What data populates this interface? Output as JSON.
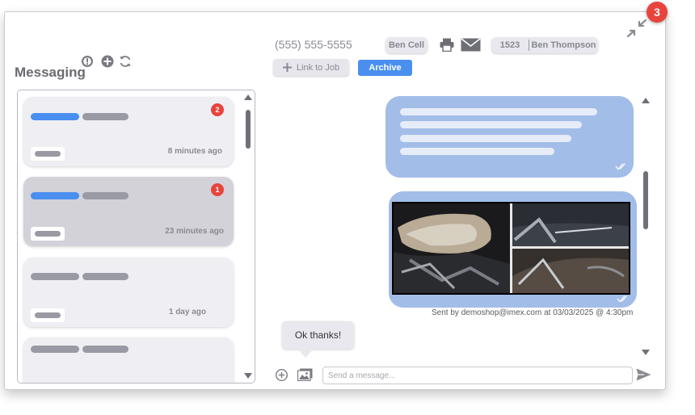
{
  "app": {
    "title": "Messaging",
    "notification_count": "3"
  },
  "contact": {
    "phone": "(555) 555-5555",
    "phone_label": "Ben Cell",
    "customer_id": "1523",
    "customer_name": "Ben Thompson"
  },
  "actions": {
    "link_label": "Link to Job",
    "archive_label": "Archive"
  },
  "conversations": [
    {
      "time": "8 minutes ago",
      "unread": "2"
    },
    {
      "time": "23 minutes ago",
      "unread": "1"
    },
    {
      "time": "1 day ago",
      "unread": ""
    },
    {
      "time": "",
      "unread": ""
    }
  ],
  "thread": {
    "sent_by": "Sent by demoshop@imex.com at 03/03/2025 @ 4:30pm",
    "incoming_text": "Ok thanks!"
  },
  "composer": {
    "placeholder": "Send a message..."
  },
  "colors": {
    "accent": "#4a8ff0",
    "outgoing_bubble": "#a3bde9",
    "badge": "#e8443c",
    "placeholder_bar": "#9a9aa4",
    "highlight_bar": "#4a8ff0"
  }
}
